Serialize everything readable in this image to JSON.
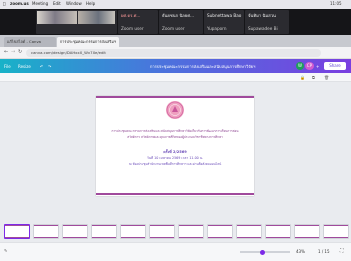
{
  "menubar": {
    "app": "zoom.us",
    "items": [
      "Meeting",
      "Edit",
      "Window",
      "Help"
    ],
    "right": "11:05"
  },
  "participants": [
    {
      "label": ""
    },
    {
      "label": ""
    },
    {
      "name": "ผศ.ดร.ศ...",
      "role": "Zoom user"
    },
    {
      "name": "ธันยชนก นิลยศ...",
      "role": "Zoom user"
    },
    {
      "name": "Subnettawa Bao",
      "role": "Yupaporn"
    },
    {
      "name": "จันทิมา ฉิมสวน",
      "role": "Supawadee Bi"
    }
  ],
  "browser": {
    "tab1": "แก้ไขสไลด์ - Canva",
    "tab2": "การประชุมคณะกรรมการส่งเสริมฯ",
    "url": "canva.com/design/DAHxxX_Wv7Xe/edit"
  },
  "canva": {
    "file": "File",
    "resize": "Resize",
    "design_title": "การประชุมคณะกรรมการส่งเสริมและสนับสนุนการศึกษาวิจัยฯ",
    "share": "Share",
    "avatar1": "W",
    "avatar2": "CP"
  },
  "slide": {
    "title_line1": "การประชุมคณะกรรมการส่งเสริมและสนับสนุนการศึกษาวิจัยเกี่ยวกับการพัฒนาการเรียนการสอน",
    "title_line2": "สวัสดิการ สวัสดิภาพและคุณภาพชีวิตของผู้ประกอบวิชาชีพทางการศึกษา",
    "session": "ครั้งที่ 2/2569",
    "date": "วันที่ 10 เมษายน 2569 เวลา 11.00 น.",
    "venue": "ณ ห้องประชุมสำนักงานเขตพื้นที่การศึกษาฯ และผ่านสื่อสังคมออนไลน์"
  },
  "status": {
    "zoom": "43%",
    "pages": "1 / 15"
  },
  "thumb_count": 12
}
